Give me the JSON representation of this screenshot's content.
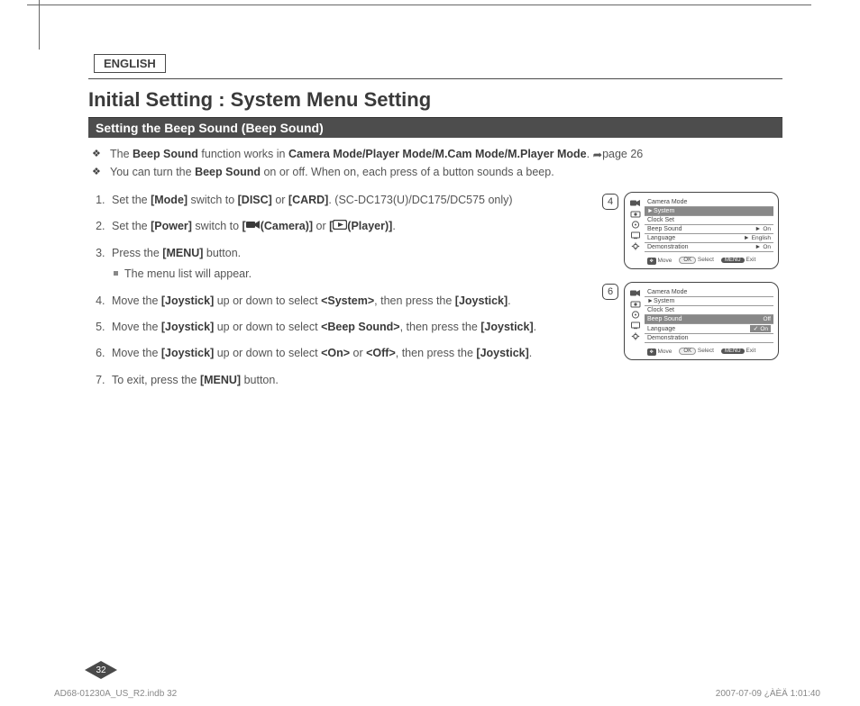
{
  "lang_tab": "ENGLISH",
  "title": "Initial Setting : System Menu Setting",
  "sub_bar": "Setting the Beep Sound (Beep Sound)",
  "bullets": {
    "b1_pre": "The ",
    "b1_bs": "Beep Sound",
    "b1_mid": " function works in ",
    "b1_modes": "Camera Mode/Player Mode/M.Cam Mode/M.Player Mode",
    "b1_end": ". ",
    "b1_page": "page 26",
    "b2_pre": "You can turn the ",
    "b2_bs": "Beep Sound",
    "b2_end": " on or off. When on, each press of a button sounds a beep."
  },
  "steps": {
    "s1_pre": "Set the ",
    "s1_mode": "[Mode]",
    "s1_mid": " switch to ",
    "s1_disc": "[DISC]",
    "s1_or": " or ",
    "s1_card": "[CARD]",
    "s1_end": ". (SC-DC173(U)/DC175/DC575 only)",
    "s2_pre": "Set the ",
    "s2_power": "[Power]",
    "s2_mid": " switch to ",
    "s2_cam_open": "[",
    "s2_cam_close": "(Camera)]",
    "s2_or": " or ",
    "s2_play_open": "[",
    "s2_play_close": "(Player)]",
    "s2_end": ".",
    "s3_pre": "Press the ",
    "s3_menu": "[MENU]",
    "s3_end": " button.",
    "s3_sub": "The menu list will appear.",
    "s4_pre": "Move the ",
    "s4_joy": "[Joystick]",
    "s4_mid": " up or down to select ",
    "s4_sys": "<System>",
    "s4_then": ", then press the ",
    "s4_joy2": "[Joystick]",
    "s4_end": ".",
    "s5_pre": "Move the ",
    "s5_joy": "[Joystick]",
    "s5_mid": " up or down to select ",
    "s5_bs": "<Beep Sound>",
    "s5_then": ", then press the ",
    "s5_joy2": "[Joystick]",
    "s5_end": ".",
    "s6_pre": "Move the ",
    "s6_joy": "[Joystick]",
    "s6_mid": " up or down to select ",
    "s6_on": "<On>",
    "s6_or": " or ",
    "s6_off": "<Off>",
    "s6_then": ", then press the ",
    "s6_joy2": "[Joystick]",
    "s6_end": ".",
    "s7_pre": "To exit, press the ",
    "s7_menu": "[MENU]",
    "s7_end": " button."
  },
  "fig": {
    "badge4": "4",
    "badge6": "6",
    "mode_title": "Camera Mode",
    "system": "System",
    "clock": "Clock Set",
    "beep": "Beep Sound",
    "lang": "Language",
    "demo": "Demonstration",
    "on": "On",
    "off": "Off",
    "english": "English",
    "move": "Move",
    "select": "Select",
    "exit": "Exit",
    "ok": "OK",
    "menu": "MENU"
  },
  "page_num": "32",
  "footer_left": "AD68-01230A_US_R2.indb   32",
  "footer_right": "2007-07-09   ¿ÀÈÄ 1:01:40"
}
